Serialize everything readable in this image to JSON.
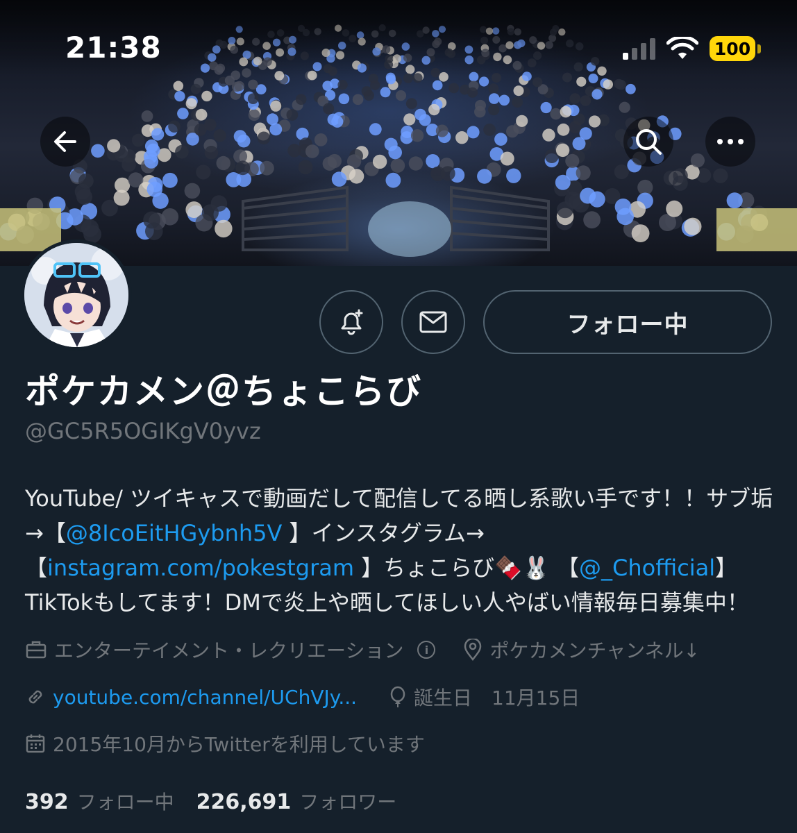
{
  "status_bar": {
    "time": "21:38",
    "battery": "100"
  },
  "header": {
    "back_icon": "arrow-left-icon",
    "search_icon": "search-icon",
    "more_icon": "ellipsis-icon"
  },
  "actions": {
    "notify_icon": "bell-plus-icon",
    "message_icon": "envelope-icon",
    "follow_label": "フォロー中"
  },
  "profile": {
    "display_name": "ポケカメン＠ちょこらび",
    "handle": "@GC5R5OGIKgV0yvz",
    "bio": {
      "t1": "YouTube/ ツイキャスで動画だして配信してる晒し系歌い手です！！サブ垢→【",
      "link1": "@8IcoEitHGybnh5V",
      "t2": " 】インスタグラム→ 【",
      "link2": "instagram.com/pokestgram",
      "t3": " 】ちょこらび🍫🐰 【",
      "link3": "@_Chofficial",
      "t4": "】TikTokもしてます！DMで炎上や晒してほしい人やばい情報毎日募集中！"
    },
    "category": "エンターテイメント・レクリエーション",
    "location": "ポケカメンチャンネル↓",
    "website": "youtube.com/channel/UChVJy...",
    "birthday": "誕生日　11月15日",
    "joined": "2015年10月からTwitterを利用しています"
  },
  "stats": {
    "following_count": "392",
    "following_label": "フォロー中",
    "followers_count": "226,691",
    "followers_label": "フォロワー"
  },
  "colors": {
    "background": "#15202b",
    "accent_link": "#1d9bf0",
    "muted_text": "#71767b",
    "battery": "#ffd60a"
  }
}
